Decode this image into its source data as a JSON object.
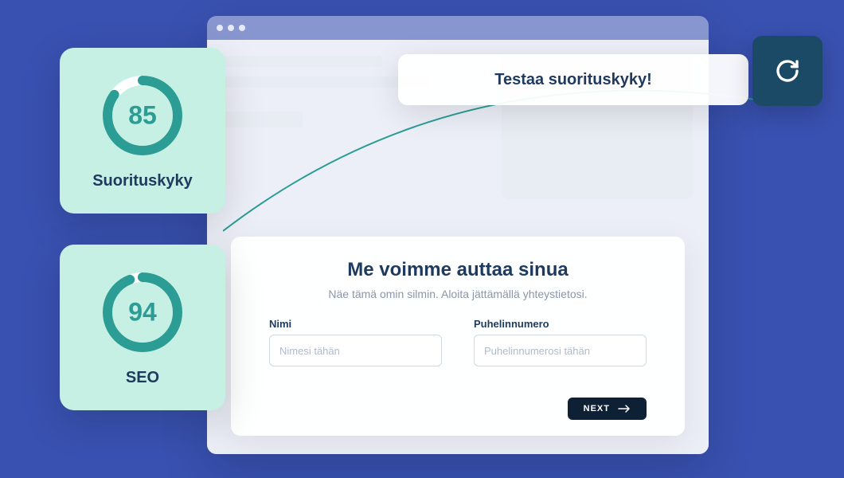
{
  "banner": {
    "text": "Testaa suorituskyky!"
  },
  "scores": {
    "performance": {
      "value": "85",
      "label": "Suorituskyky",
      "percent": 85
    },
    "seo": {
      "value": "94",
      "label": "SEO",
      "percent": 94
    }
  },
  "form": {
    "title": "Me voimme auttaa sinua",
    "subtitle": "Näe tämä omin silmin. Aloita jättämällä yhteystietosi.",
    "name_label": "Nimi",
    "name_placeholder": "Nimesi tähän",
    "phone_label": "Puhelinnumero",
    "phone_placeholder": "Puhelinnumerosi tähän",
    "next_label": "NEXT"
  },
  "colors": {
    "ring": "#2b9d94",
    "ring_bg": "#ffffff"
  }
}
